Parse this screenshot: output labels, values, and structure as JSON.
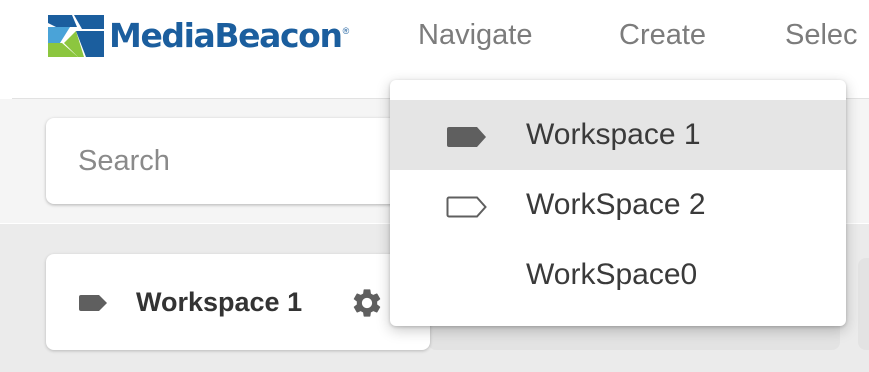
{
  "header": {
    "logo_text": "MediaBeacon",
    "logo_reg": "®",
    "nav": {
      "navigate": "Navigate",
      "create": "Create",
      "select": "Selec"
    }
  },
  "search": {
    "placeholder": "Search",
    "value": ""
  },
  "workspace_card": {
    "label": "Workspace 1",
    "tag_icon": "tag-filled-icon",
    "settings_icon": "gear-icon"
  },
  "workspace_menu": {
    "items": [
      {
        "label": "Workspace 1",
        "icon": "tag-filled-icon",
        "selected": true
      },
      {
        "label": "WorkSpace 2",
        "icon": "tag-outline-icon",
        "selected": false
      },
      {
        "label": "WorkSpace0",
        "icon": "",
        "selected": false
      }
    ]
  },
  "colors": {
    "brand_blue": "#1b5e9e",
    "brand_green": "#8cc63f",
    "nav_text": "#7c7c7c",
    "tag_gray": "#5f5f5f",
    "selected_bg": "#e5e5e5"
  }
}
